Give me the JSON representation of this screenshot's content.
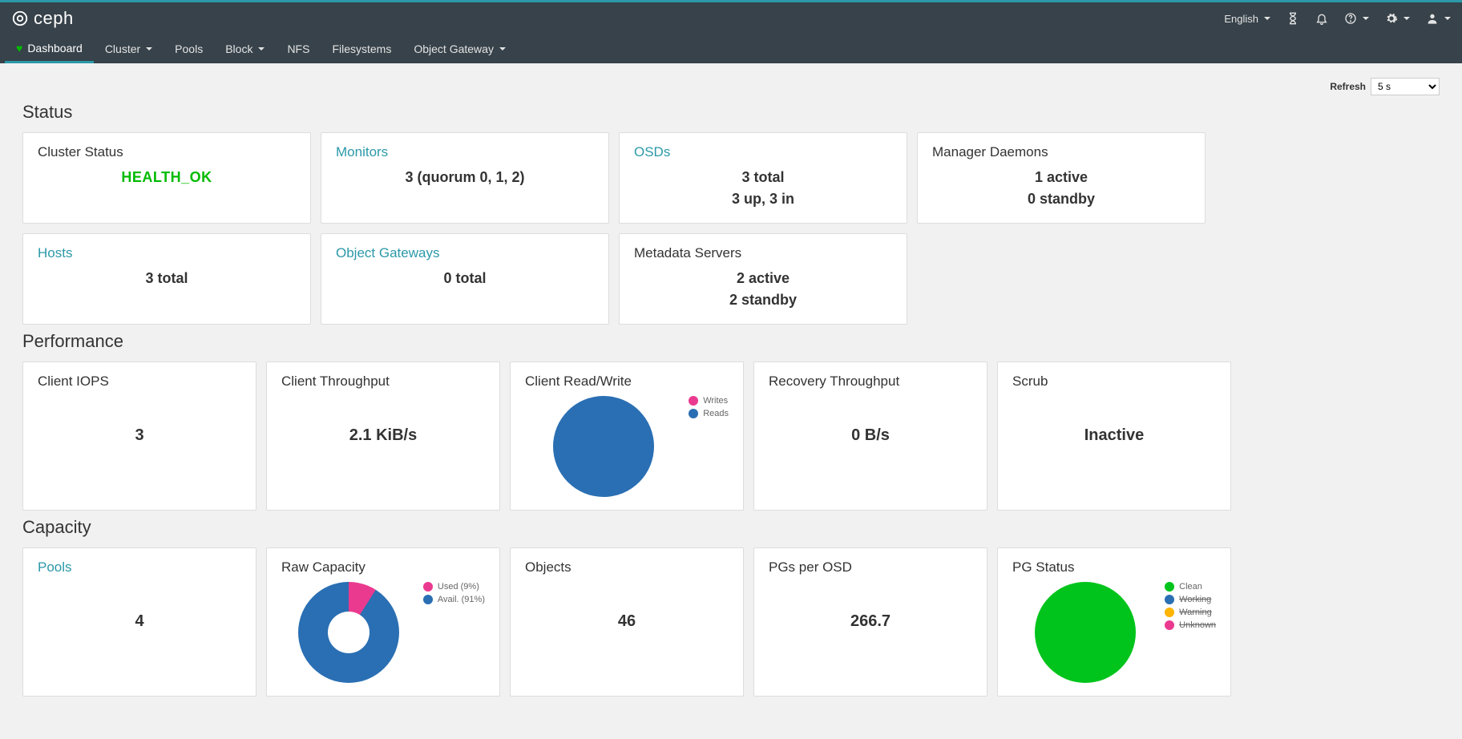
{
  "header": {
    "brand": "ceph",
    "language": "English"
  },
  "nav": {
    "dashboard": "Dashboard",
    "cluster": "Cluster",
    "pools": "Pools",
    "block": "Block",
    "nfs": "NFS",
    "filesystems": "Filesystems",
    "object_gateway": "Object Gateway"
  },
  "refresh": {
    "label": "Refresh",
    "value": "5 s"
  },
  "sections": {
    "status": "Status",
    "performance": "Performance",
    "capacity": "Capacity"
  },
  "status": {
    "cluster_status": {
      "title": "Cluster Status",
      "value": "HEALTH_OK"
    },
    "monitors": {
      "title": "Monitors",
      "value": "3 (quorum 0, 1, 2)"
    },
    "osds": {
      "title": "OSDs",
      "line1": "3 total",
      "line2": "3 up, 3 in"
    },
    "mgr": {
      "title": "Manager Daemons",
      "line1": "1 active",
      "line2": "0 standby"
    },
    "hosts": {
      "title": "Hosts",
      "value": "3 total"
    },
    "rgw": {
      "title": "Object Gateways",
      "value": "0 total"
    },
    "mds": {
      "title": "Metadata Servers",
      "line1": "2 active",
      "line2": "2 standby"
    }
  },
  "performance": {
    "client_iops": {
      "title": "Client IOPS",
      "value": "3"
    },
    "client_throughput": {
      "title": "Client Throughput",
      "value": "2.1 KiB/s"
    },
    "client_rw": {
      "title": "Client Read/Write",
      "legend_writes": "Writes",
      "legend_reads": "Reads"
    },
    "recovery": {
      "title": "Recovery Throughput",
      "value": "0 B/s"
    },
    "scrub": {
      "title": "Scrub",
      "value": "Inactive"
    }
  },
  "capacity": {
    "pools": {
      "title": "Pools",
      "value": "4"
    },
    "raw": {
      "title": "Raw Capacity",
      "legend_used": "Used (9%)",
      "legend_avail": "Avail. (91%)"
    },
    "objects": {
      "title": "Objects",
      "value": "46"
    },
    "pgs_per_osd": {
      "title": "PGs per OSD",
      "value": "266.7"
    },
    "pg_status": {
      "title": "PG Status",
      "legend_clean": "Clean",
      "legend_working": "Working",
      "legend_warning": "Warning",
      "legend_unknown": "Unknown"
    }
  },
  "colors": {
    "blue": "#2a6fb3",
    "pink": "#ea3a8f",
    "green": "#00c41c",
    "orange": "#ffb400"
  },
  "chart_data": [
    {
      "type": "pie",
      "name": "client_rw",
      "series": [
        {
          "name": "Reads",
          "value": 100,
          "color": "#2a6fb3"
        },
        {
          "name": "Writes",
          "value": 0,
          "color": "#ea3a8f"
        }
      ]
    },
    {
      "type": "pie",
      "name": "raw_capacity",
      "series": [
        {
          "name": "Used",
          "value": 9,
          "color": "#ea3a8f"
        },
        {
          "name": "Avail.",
          "value": 91,
          "color": "#2a6fb3"
        }
      ],
      "donut": true
    },
    {
      "type": "pie",
      "name": "pg_status",
      "series": [
        {
          "name": "Clean",
          "value": 100,
          "color": "#00c41c"
        },
        {
          "name": "Working",
          "value": 0,
          "color": "#2a6fb3"
        },
        {
          "name": "Warning",
          "value": 0,
          "color": "#ffb400"
        },
        {
          "name": "Unknown",
          "value": 0,
          "color": "#ea3a8f"
        }
      ]
    }
  ]
}
